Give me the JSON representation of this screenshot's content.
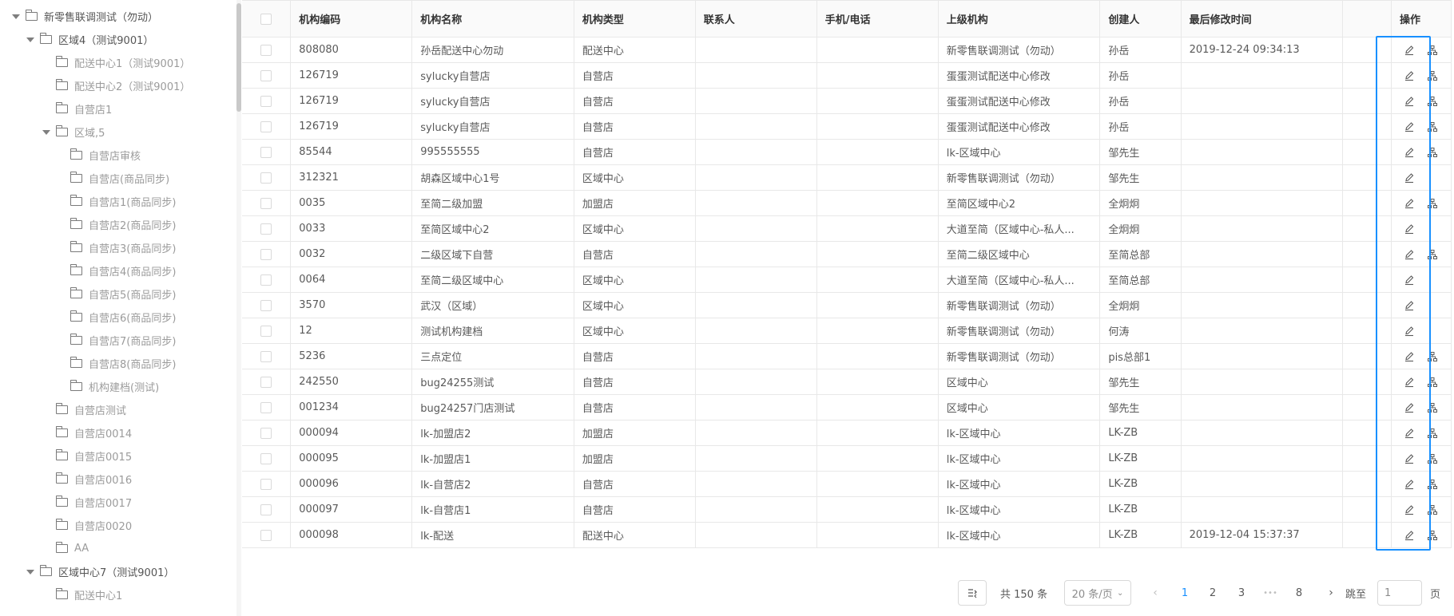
{
  "tree": [
    {
      "label": "新零售联调测试（勿动）",
      "level": 0,
      "expanded": true
    },
    {
      "label": "区域4（测试9001）",
      "level": 1,
      "expanded": true
    },
    {
      "label": "配送中心1（测试9001）",
      "level": 2
    },
    {
      "label": "配送中心2（测试9001）",
      "level": 2
    },
    {
      "label": "自营店1",
      "level": 2
    },
    {
      "label": "区域,5",
      "level": 2,
      "expanded": true
    },
    {
      "label": "自营店审核",
      "level": 3
    },
    {
      "label": "自营店(商品同步)",
      "level": 3
    },
    {
      "label": "自营店1(商品同步)",
      "level": 3
    },
    {
      "label": "自营店2(商品同步)",
      "level": 3
    },
    {
      "label": "自营店3(商品同步)",
      "level": 3
    },
    {
      "label": "自营店4(商品同步)",
      "level": 3
    },
    {
      "label": "自营店5(商品同步)",
      "level": 3
    },
    {
      "label": "自营店6(商品同步)",
      "level": 3
    },
    {
      "label": "自营店7(商品同步)",
      "level": 3
    },
    {
      "label": "自营店8(商品同步)",
      "level": 3
    },
    {
      "label": "机构建档(测试)",
      "level": 3
    },
    {
      "label": "自营店测试",
      "level": 2
    },
    {
      "label": "自营店0014",
      "level": 2
    },
    {
      "label": "自营店0015",
      "level": 2
    },
    {
      "label": "自营店0016",
      "level": 2
    },
    {
      "label": "自营店0017",
      "level": 2
    },
    {
      "label": "自营店0020",
      "level": 2
    },
    {
      "label": "AA",
      "level": 2
    },
    {
      "label": "区域中心7（测试9001）",
      "level": 1,
      "expanded": true
    },
    {
      "label": "配送中心1",
      "level": 2
    }
  ],
  "table": {
    "columns": [
      "机构编码",
      "机构名称",
      "机构类型",
      "联系人",
      "手机/电话",
      "上级机构",
      "创建人",
      "最后修改时间",
      "操作"
    ],
    "rows": [
      {
        "code": "808080",
        "name": "孙岳配送中心勿动",
        "type": "配送中心",
        "contact": "",
        "phone": "",
        "parent": "新零售联调测试（勿动）",
        "creator": "孙岳",
        "modified": "2019-12-24 09:34:13",
        "ops": [
          "edit",
          "org"
        ]
      },
      {
        "code": "126719",
        "name": "sylucky自营店",
        "type": "自营店",
        "contact": "",
        "phone": "",
        "parent": "蛋蛋测试配送中心修改",
        "creator": "孙岳",
        "modified": "",
        "ops": [
          "edit",
          "org"
        ]
      },
      {
        "code": "126719",
        "name": "sylucky自营店",
        "type": "自营店",
        "contact": "",
        "phone": "",
        "parent": "蛋蛋测试配送中心修改",
        "creator": "孙岳",
        "modified": "",
        "ops": [
          "edit",
          "org"
        ]
      },
      {
        "code": "126719",
        "name": "sylucky自营店",
        "type": "自营店",
        "contact": "",
        "phone": "",
        "parent": "蛋蛋测试配送中心修改",
        "creator": "孙岳",
        "modified": "",
        "ops": [
          "edit",
          "org"
        ]
      },
      {
        "code": "85544",
        "name": "995555555",
        "type": "自营店",
        "contact": "",
        "phone": "",
        "parent": "lk-区域中心",
        "creator": "邹先生",
        "modified": "",
        "ops": [
          "edit",
          "org"
        ]
      },
      {
        "code": "312321",
        "name": "胡森区域中心1号",
        "type": "区域中心",
        "contact": "",
        "phone": "",
        "parent": "新零售联调测试（勿动）",
        "creator": "邹先生",
        "modified": "",
        "ops": [
          "edit"
        ]
      },
      {
        "code": "0035",
        "name": "至简二级加盟",
        "type": "加盟店",
        "contact": "",
        "phone": "",
        "parent": "至简区域中心2",
        "creator": "全炯炯",
        "modified": "",
        "ops": [
          "edit",
          "org"
        ]
      },
      {
        "code": "0033",
        "name": "至简区域中心2",
        "type": "区域中心",
        "contact": "",
        "phone": "",
        "parent": "大道至简（区域中心-私人...",
        "creator": "全炯炯",
        "modified": "",
        "ops": [
          "edit"
        ]
      },
      {
        "code": "0032",
        "name": "二级区域下自营",
        "type": "自营店",
        "contact": "",
        "phone": "",
        "parent": "至简二级区域中心",
        "creator": "至简总部",
        "modified": "",
        "ops": [
          "edit",
          "org"
        ]
      },
      {
        "code": "0064",
        "name": "至简二级区域中心",
        "type": "区域中心",
        "contact": "",
        "phone": "",
        "parent": "大道至简（区域中心-私人...",
        "creator": "至简总部",
        "modified": "",
        "ops": [
          "edit"
        ]
      },
      {
        "code": "3570",
        "name": "武汉（区域）",
        "type": "区域中心",
        "contact": "",
        "phone": "",
        "parent": "新零售联调测试（勿动）",
        "creator": "全炯炯",
        "modified": "",
        "ops": [
          "edit"
        ]
      },
      {
        "code": "12",
        "name": "测试机构建档",
        "type": "区域中心",
        "contact": "",
        "phone": "",
        "parent": "新零售联调测试（勿动）",
        "creator": "何涛",
        "modified": "",
        "ops": [
          "edit"
        ]
      },
      {
        "code": "5236",
        "name": "三点定位",
        "type": "自营店",
        "contact": "",
        "phone": "",
        "parent": "新零售联调测试（勿动）",
        "creator": "pis总部1",
        "modified": "",
        "ops": [
          "edit",
          "org"
        ]
      },
      {
        "code": "242550",
        "name": "bug24255测试",
        "type": "自营店",
        "contact": "",
        "phone": "",
        "parent": "区域中心",
        "creator": "邹先生",
        "modified": "",
        "ops": [
          "edit",
          "org"
        ]
      },
      {
        "code": "001234",
        "name": "bug24257门店测试",
        "type": "自营店",
        "contact": "",
        "phone": "",
        "parent": "区域中心",
        "creator": "邹先生",
        "modified": "",
        "ops": [
          "edit",
          "org"
        ]
      },
      {
        "code": "000094",
        "name": "lk-加盟店2",
        "type": "加盟店",
        "contact": "",
        "phone": "",
        "parent": "lk-区域中心",
        "creator": "LK-ZB",
        "modified": "",
        "ops": [
          "edit",
          "org"
        ]
      },
      {
        "code": "000095",
        "name": "lk-加盟店1",
        "type": "加盟店",
        "contact": "",
        "phone": "",
        "parent": "lk-区域中心",
        "creator": "LK-ZB",
        "modified": "",
        "ops": [
          "edit",
          "org"
        ]
      },
      {
        "code": "000096",
        "name": "lk-自营店2",
        "type": "自营店",
        "contact": "",
        "phone": "",
        "parent": "lk-区域中心",
        "creator": "LK-ZB",
        "modified": "",
        "ops": [
          "edit",
          "org"
        ]
      },
      {
        "code": "000097",
        "name": "lk-自营店1",
        "type": "自营店",
        "contact": "",
        "phone": "",
        "parent": "lk-区域中心",
        "creator": "LK-ZB",
        "modified": "",
        "ops": [
          "edit",
          "org"
        ]
      },
      {
        "code": "000098",
        "name": "lk-配送",
        "type": "配送中心",
        "contact": "",
        "phone": "",
        "parent": "lk-区域中心",
        "creator": "LK-ZB",
        "modified": "2019-12-04 15:37:37",
        "ops": [
          "edit",
          "org"
        ]
      }
    ]
  },
  "pagination": {
    "total_text": "共 150 条",
    "page_size": "20 条/页",
    "pages": [
      "1",
      "2",
      "3",
      "•••",
      "8"
    ],
    "current": "1",
    "jump_label": "跳至",
    "jump_value": "1",
    "page_suffix": "页"
  },
  "colors": {
    "accent": "#1890ff",
    "border": "#e8e8e8",
    "header_bg": "#fafafa"
  }
}
